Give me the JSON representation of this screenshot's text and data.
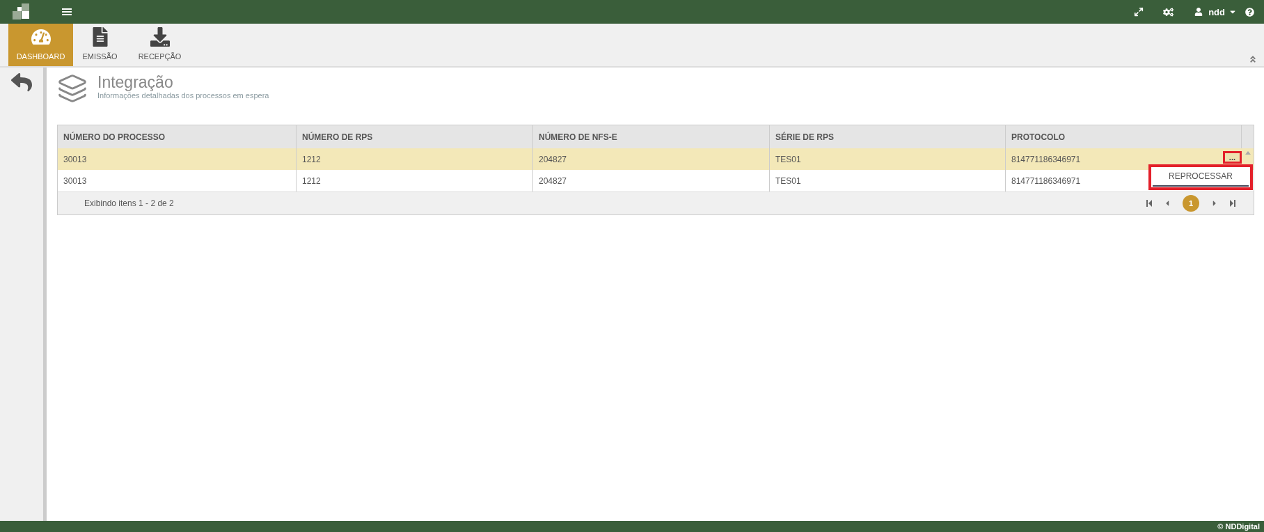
{
  "top_bar": {
    "user": "ndd"
  },
  "nav_tabs": [
    {
      "label": "DASHBOARD",
      "selected": true
    },
    {
      "label": "EMISSÃO",
      "selected": false
    },
    {
      "label": "RECEPÇÃO",
      "selected": false
    }
  ],
  "page_header": {
    "title": "Integração",
    "subtitle": "Informações detalhadas dos processos em espera"
  },
  "table": {
    "columns": [
      "NÚMERO DO PROCESSO",
      "NÚMERO DE RPS",
      "NÚMERO DE NFS-E",
      "SÉRIE DE RPS",
      "PROTOCOLO"
    ],
    "rows": [
      {
        "cells": [
          "30013",
          "1212",
          "204827",
          "TES01",
          "814771186346971"
        ],
        "selected": true,
        "actions_button": {
          "label": "...",
          "highlighted": true
        }
      },
      {
        "cells": [
          "30013",
          "1212",
          "204827",
          "TES01",
          "814771186346971"
        ],
        "selected": false
      }
    ],
    "actions_menu": {
      "items": [
        "REPROCESSAR"
      ],
      "highlighted": true
    },
    "footer": {
      "summary": "Exibindo itens 1 - 2 de 2",
      "pages": [
        {
          "label": "1",
          "selected": true
        }
      ]
    }
  },
  "footer": {
    "copyright": "© NDDigital"
  }
}
